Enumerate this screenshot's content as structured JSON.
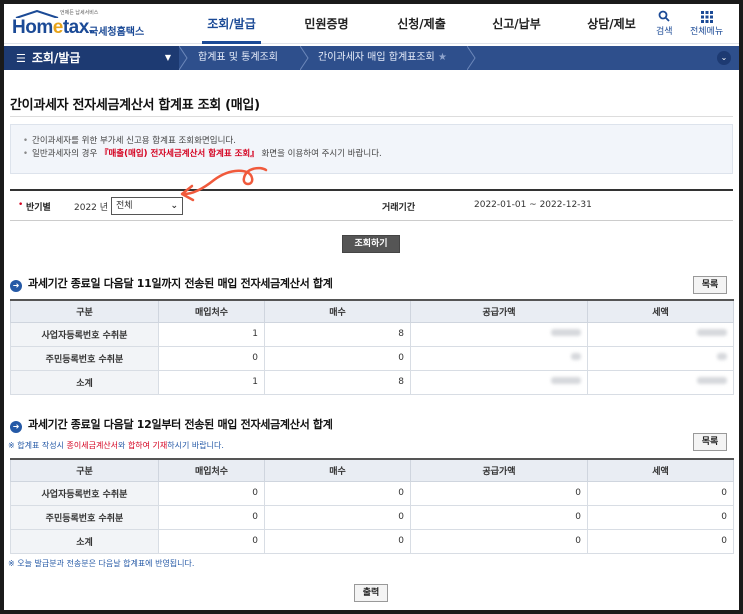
{
  "header": {
    "logo_tagline": "언제든 납세서비스",
    "logo_brand_pre": "Hom",
    "logo_brand_e": "e",
    "logo_brand_post": "tax.",
    "logo_kr": "국세청홈택스",
    "nav": [
      "조회/발급",
      "민원증명",
      "신청/제출",
      "신고/납부",
      "상담/제보"
    ],
    "search_label": "검색",
    "allmenu_label": "전체메뉴"
  },
  "locbar": {
    "first": "조회/발급",
    "crumbs": [
      "합계표 및 통계조회",
      "간이과세자 매입 합계표조회"
    ]
  },
  "page": {
    "title": "간이과세자 전자세금계산서 합계표 조회 (매입)",
    "info_line1": "간이과세자를 위한 부가세 신고용 합계표 조회화면입니다.",
    "info_line2_pre": "일반과세자의 경우 ",
    "info_line2_red": "『매출(매입) 전자세금계산서 합계표 조회』",
    "info_line2_post": " 화면을 이용하여 주시기 바랍니다."
  },
  "search": {
    "required_mark": "•",
    "label_half": "반기별",
    "year": "2022 년",
    "select_value": "전체",
    "label_period": "거래기간",
    "period_value": "2022-01-01 ~ 2022-12-31",
    "submit_label": "조회하기"
  },
  "section1": {
    "title": "과세기간 종료일 다음달 11일까지 전송된 매입 전자세금계산서 합계",
    "list_button": "목록",
    "headers": [
      "구분",
      "매입처수",
      "매수",
      "공급가액",
      "세액"
    ],
    "rows": [
      {
        "label": "사업자등록번호 수취분",
        "count": "1",
        "sheets": "8"
      },
      {
        "label": "주민등록번호 수취분",
        "count": "0",
        "sheets": "0"
      },
      {
        "label": "소계",
        "count": "1",
        "sheets": "8"
      }
    ]
  },
  "section2": {
    "title": "과세기간 종료일 다음달 12일부터 전송된 매입 전자세금계산서 합계",
    "note_pre": "※ 합계표 작성시 ",
    "note_red1": "종이세금계산서",
    "note_mid": "와 ",
    "note_red2": "합하여 기재",
    "note_post": "하시기 바랍니다.",
    "list_button": "목록",
    "headers": [
      "구분",
      "매입처수",
      "매수",
      "공급가액",
      "세액"
    ],
    "rows": [
      {
        "label": "사업자등록번호 수취분",
        "count": "0",
        "sheets": "0",
        "supply": "0",
        "tax": "0"
      },
      {
        "label": "주민등록번호 수취분",
        "count": "0",
        "sheets": "0",
        "supply": "0",
        "tax": "0"
      },
      {
        "label": "소계",
        "count": "0",
        "sheets": "0",
        "supply": "0",
        "tax": "0"
      }
    ]
  },
  "footer": {
    "note": "※ 오늘 발급분과 전송분은 다음날 합계표에  반영됩니다.",
    "print_label": "출력"
  },
  "colors": {
    "brand": "#1b4a96",
    "locbar": "#2e4f8c",
    "alert": "#d4001f"
  }
}
